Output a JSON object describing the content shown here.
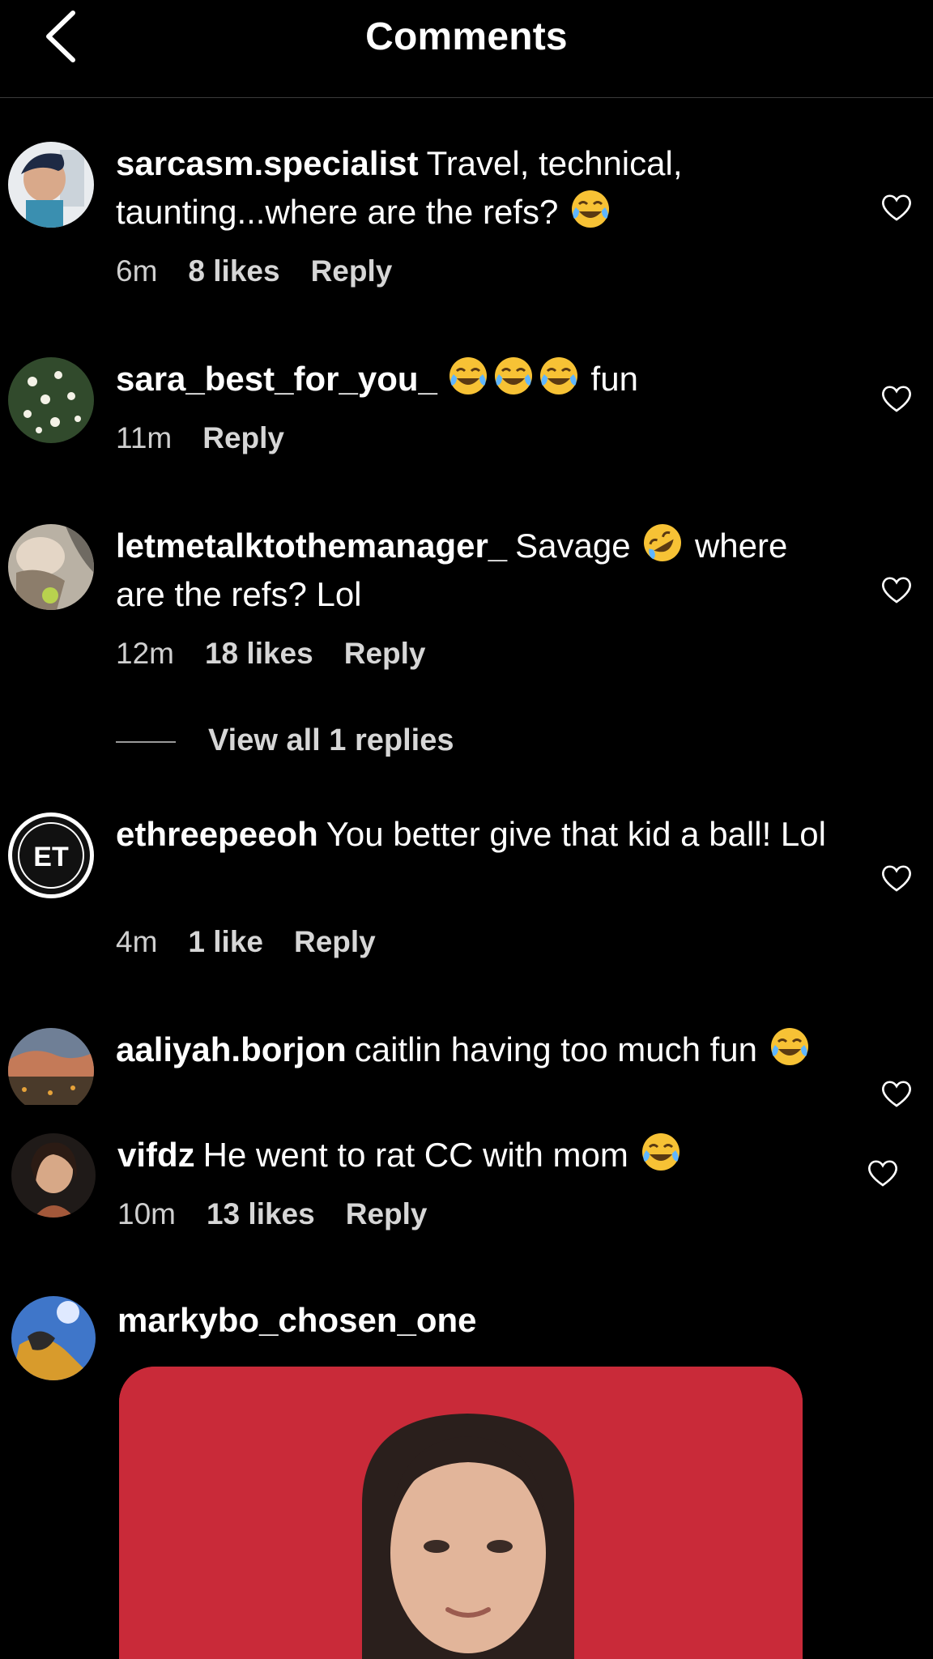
{
  "header": {
    "title": "Comments",
    "back_icon": "chevron-left-icon"
  },
  "comments": [
    {
      "username": "sarcasm.specialist",
      "text": "Travel, technical, taunting...where are the refs?",
      "emojis": [
        "😂"
      ],
      "time": "6m",
      "likes": "8 likes",
      "reply": "Reply"
    },
    {
      "username": "sara_best_for_you_",
      "text": "fun",
      "emojis": [
        "😂",
        "😂",
        "😂"
      ],
      "time": "11m",
      "likes": "",
      "reply": "Reply"
    },
    {
      "username": "letmetalktothemanager_",
      "text_before": "Savage",
      "text_after": "where are the refs? Lol",
      "emojis": [
        "🤣"
      ],
      "time": "12m",
      "likes": "18 likes",
      "reply": "Reply"
    },
    {
      "username": "ethreepeeoh",
      "text": "You better give that kid a ball! Lol",
      "time": "4m",
      "likes": "1 like",
      "reply": "Reply"
    },
    {
      "username": "aaliyah.borjon",
      "text": "caitlin having too much fun",
      "emojis": [
        "😂"
      ]
    },
    {
      "username": "vifdz",
      "text": "He went to rat CC with mom",
      "emojis": [
        "😂"
      ],
      "time": "10m",
      "likes": "13 likes",
      "reply": "Reply"
    },
    {
      "username": "markybo_chosen_one"
    }
  ],
  "view_replies": "View all 1 replies",
  "avatar_text": {
    "ethreepeeoh": "ET"
  },
  "colors": {
    "background": "#000000",
    "text": "#ffffff",
    "meta": "#cfcfcf",
    "media_bg": "#c92a39",
    "divider": "#3a3a3a"
  }
}
